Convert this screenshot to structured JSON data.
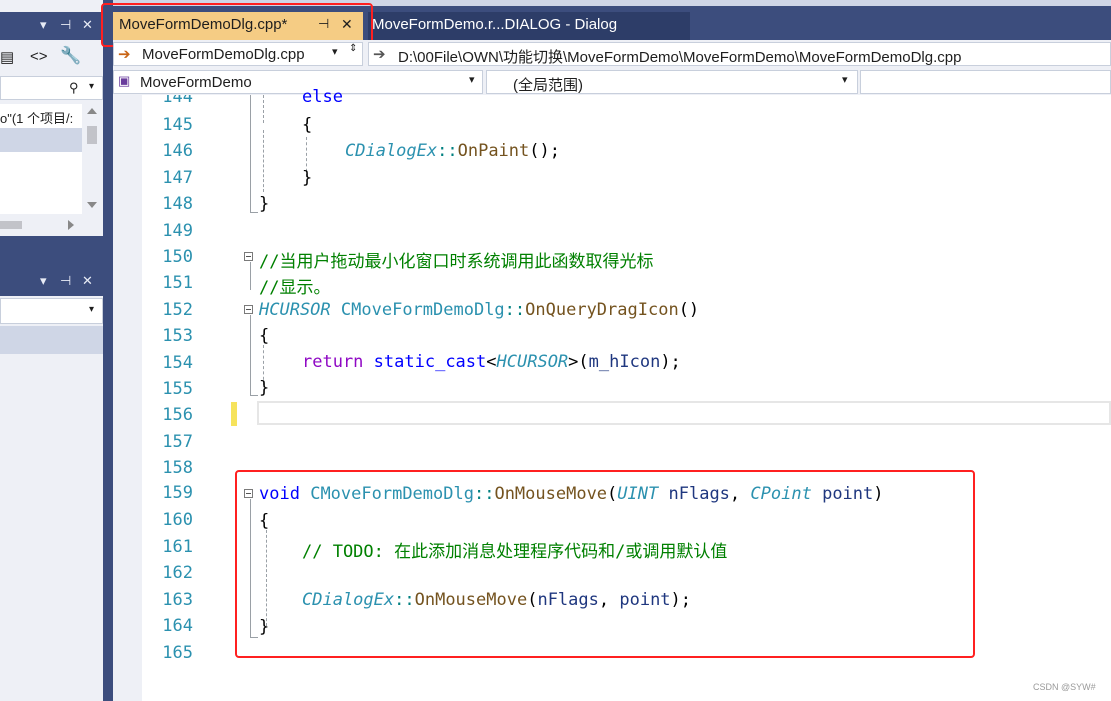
{
  "tabs": [
    {
      "label": "MoveFormDemoDlg.cpp*",
      "pin": "⊣",
      "close": "✕"
    },
    {
      "label": "MoveFormDemo.r...DIALOG - Dialog"
    }
  ],
  "nav": {
    "file_combo": "MoveFormDemoDlg.cpp",
    "file_path": "D:\\00File\\OWN\\功能切换\\MoveFormDemo\\MoveFormDemo\\MoveFormDemoDlg.cpp",
    "project_combo": "MoveFormDemo",
    "scope_combo": "(全局范围)"
  },
  "left_panel": {
    "search_text": "o\"(1 个项目/:"
  },
  "code": {
    "l144": "else",
    "l145": "{",
    "l146_cls": "CDialogEx",
    "l146_fn": "OnPaint",
    "l146_rest": "();",
    "l147": "}",
    "l148": "}",
    "l150": "//当用户拖动最小化窗口时系统调用此函数取得光标",
    "l151": "//显示。",
    "l152_type": "HCURSOR",
    "l152_cls": "CMoveFormDemoDlg",
    "l152_fn": "OnQueryDragIcon",
    "l152_rest": "()",
    "l153": "{",
    "l154_kw": "return",
    "l154_kw2": "static_cast",
    "l154_type": "HCURSOR",
    "l154_mem": "m_hIcon",
    "l155": "}",
    "l159_kw": "void",
    "l159_cls": "CMoveFormDemoDlg",
    "l159_fn": "OnMouseMove",
    "l159_t1": "UINT",
    "l159_p1": "nFlags",
    "l159_t2": "CPoint",
    "l159_p2": "point",
    "l160": "{",
    "l161": "// TODO: 在此添加消息处理程序代码和/或调用默认值",
    "l163_cls": "CDialogEx",
    "l163_fn": "OnMouseMove",
    "l163_p1": "nFlags",
    "l163_p2": "point",
    "l164": "}"
  },
  "line_numbers": [
    "144",
    "145",
    "146",
    "147",
    "148",
    "149",
    "150",
    "151",
    "152",
    "153",
    "154",
    "155",
    "156",
    "157",
    "158",
    "159",
    "160",
    "161",
    "162",
    "163",
    "164",
    "165"
  ],
  "watermark": "CSDN @SYW#",
  "colors": {
    "highlight": "#ff2020",
    "active_tab": "#f5cc84",
    "chrome": "#3c4d7d"
  }
}
